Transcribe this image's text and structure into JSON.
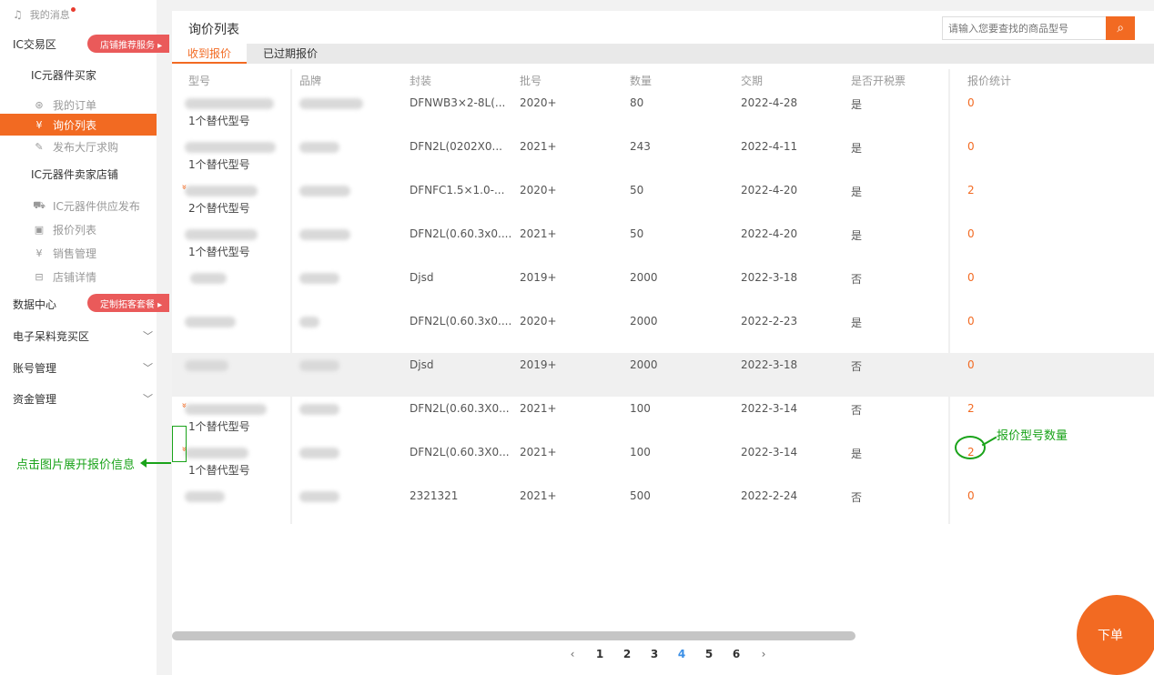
{
  "sidebar": {
    "messages": "我的消息",
    "ic_trade": "IC交易区",
    "promo_shop": "店铺推荐服务 ▸",
    "buyer_group": "IC元器件买家",
    "buyer_items": [
      {
        "icon": "order-icon",
        "label": "我的订单"
      },
      {
        "icon": "list-icon",
        "label": "询价列表"
      },
      {
        "icon": "publish-icon",
        "label": "发布大厅求购"
      }
    ],
    "seller_group": "IC元器件卖家店铺",
    "seller_items": [
      {
        "icon": "truck-icon",
        "label": "IC元器件供应发布"
      },
      {
        "icon": "quote-icon",
        "label": "报价列表"
      },
      {
        "icon": "sales-icon",
        "label": "销售管理"
      },
      {
        "icon": "shop-icon",
        "label": "店铺详情"
      }
    ],
    "data_center": "数据中心",
    "promo_custom": "定制拓客套餐 ▸",
    "stock_zone": "电子呆料竞买区",
    "account": "账号管理",
    "funds": "资金管理",
    "annotation": "点击图片展开报价信息"
  },
  "main": {
    "title": "询价列表",
    "search_placeholder": "请输入您要查找的商品型号",
    "tabs": [
      "收到报价",
      "已过期报价"
    ],
    "columns": [
      "型号",
      "品牌",
      "封装",
      "批号",
      "数量",
      "交期",
      "是否开税票",
      "报价统计"
    ],
    "rows": [
      {
        "alt": "1个替代型号",
        "pkg": "DFNWB3×2-8L(...",
        "batch": "2020+",
        "qty": "80",
        "date": "2022-4-28",
        "tax": "是",
        "count": "0",
        "expand": false
      },
      {
        "alt": "1个替代型号",
        "pkg": "DFN2L(0202X0...",
        "batch": "2021+",
        "qty": "243",
        "date": "2022-4-11",
        "tax": "是",
        "count": "0",
        "expand": false
      },
      {
        "alt": "2个替代型号",
        "pkg": "DFNFC1.5×1.0-...",
        "batch": "2020+",
        "qty": "50",
        "date": "2022-4-20",
        "tax": "是",
        "count": "2",
        "expand": true
      },
      {
        "alt": "1个替代型号",
        "pkg": "DFN2L(0.60.3x0....",
        "batch": "2021+",
        "qty": "50",
        "date": "2022-4-20",
        "tax": "是",
        "count": "0",
        "expand": false
      },
      {
        "alt": "",
        "pkg": "Djsd",
        "batch": "2019+",
        "qty": "2000",
        "date": "2022-3-18",
        "tax": "否",
        "count": "0",
        "expand": false
      },
      {
        "alt": "",
        "pkg": "DFN2L(0.60.3x0....",
        "batch": "2020+",
        "qty": "2000",
        "date": "2022-2-23",
        "tax": "是",
        "count": "0",
        "expand": false
      },
      {
        "alt": "",
        "pkg": "Djsd",
        "batch": "2019+",
        "qty": "2000",
        "date": "2022-3-18",
        "tax": "否",
        "count": "0",
        "expand": false
      },
      {
        "alt": "1个替代型号",
        "pkg": "DFN2L(0.60.3X0...",
        "batch": "2021+",
        "qty": "100",
        "date": "2022-3-14",
        "tax": "否",
        "count": "2",
        "expand": true
      },
      {
        "alt": "1个替代型号",
        "pkg": "DFN2L(0.60.3X0...",
        "batch": "2021+",
        "qty": "100",
        "date": "2022-3-14",
        "tax": "是",
        "count": "2",
        "expand": true
      },
      {
        "alt": "",
        "pkg": "2321321",
        "batch": "2021+",
        "qty": "500",
        "date": "2022-2-24",
        "tax": "否",
        "count": "0",
        "expand": false
      }
    ],
    "annotation": "报价型号数量",
    "pager": [
      "‹",
      "1",
      "2",
      "3",
      "4",
      "5",
      "6",
      "›"
    ],
    "current_page": "4",
    "order_button": "下单"
  },
  "colors": {
    "accent": "#f26a22",
    "annotation": "#1aa31a",
    "promo": "#ea5a5a",
    "current_page": "#3b8fe6"
  }
}
